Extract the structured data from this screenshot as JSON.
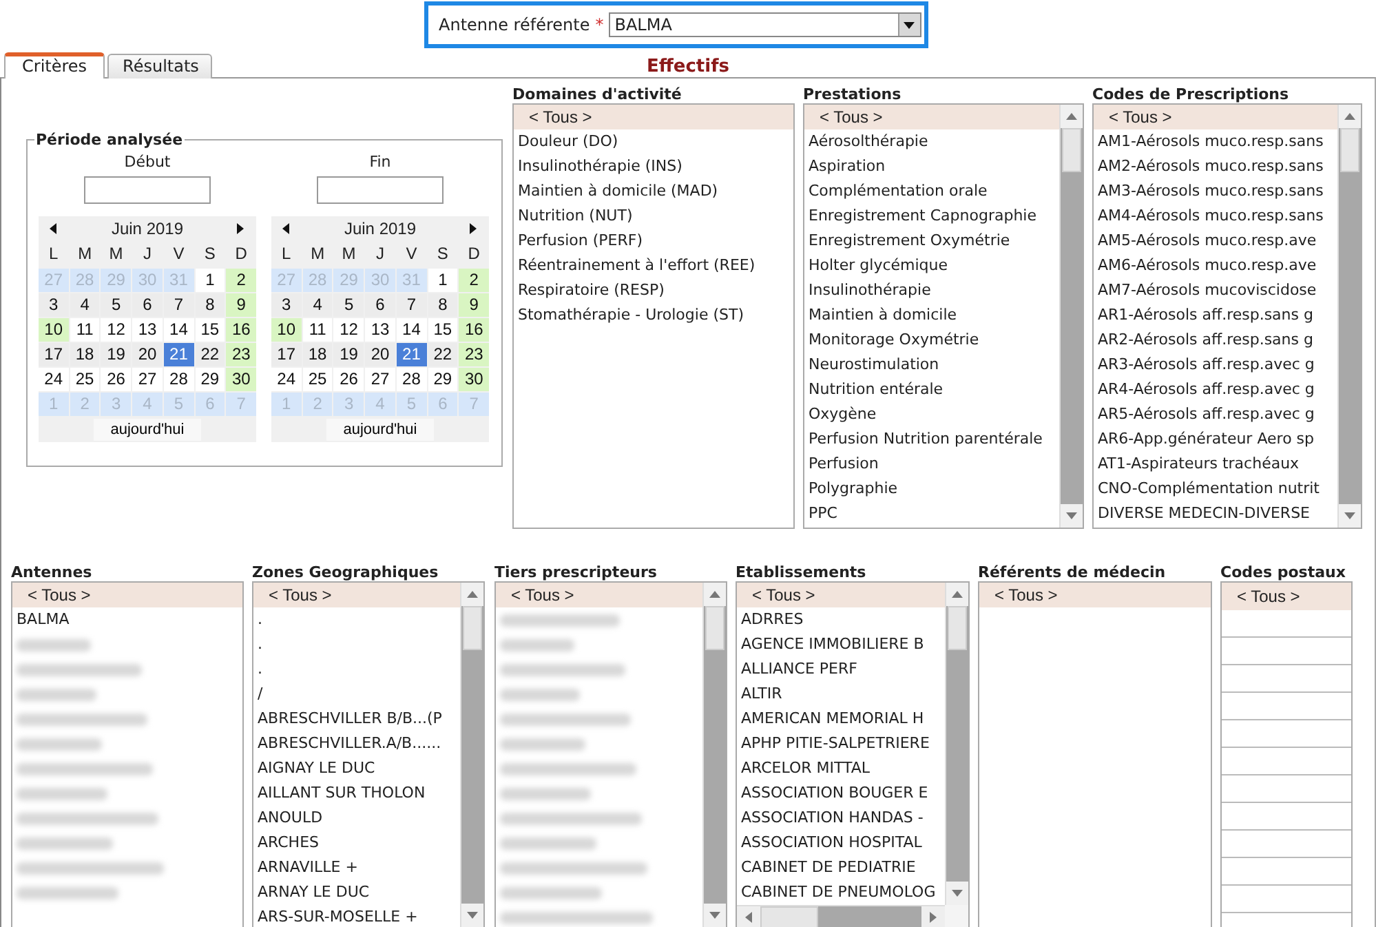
{
  "antenne": {
    "label": "Antenne référente",
    "required_mark": "*",
    "value": "BALMA"
  },
  "tabs": [
    {
      "label": "Critères",
      "selected": true
    },
    {
      "label": "Résultats",
      "selected": false
    }
  ],
  "title": "Effectifs",
  "periode": {
    "legend": "Période analysée",
    "fields": [
      {
        "label": "Début",
        "calendar": {
          "month": "Juin 2019",
          "weekdays": [
            "L",
            "M",
            "M",
            "J",
            "V",
            "S",
            "D"
          ],
          "today_button": "aujourd'hui",
          "weeks": [
            [
              {
                "day": "27",
                "kind": "other",
                "selected": false
              },
              {
                "day": "28",
                "kind": "other",
                "selected": false
              },
              {
                "day": "29",
                "kind": "other",
                "selected": false
              },
              {
                "day": "30",
                "kind": "other",
                "selected": false
              },
              {
                "day": "31",
                "kind": "other",
                "selected": false
              },
              {
                "day": "1",
                "kind": "day",
                "selected": false
              },
              {
                "day": "2",
                "kind": "weekend",
                "selected": false
              }
            ],
            [
              {
                "day": "3",
                "kind": "day",
                "selected": false
              },
              {
                "day": "4",
                "kind": "day",
                "selected": false
              },
              {
                "day": "5",
                "kind": "day",
                "selected": false
              },
              {
                "day": "6",
                "kind": "day",
                "selected": false
              },
              {
                "day": "7",
                "kind": "day",
                "selected": false
              },
              {
                "day": "8",
                "kind": "day",
                "selected": false
              },
              {
                "day": "9",
                "kind": "weekend",
                "selected": false
              }
            ],
            [
              {
                "day": "10",
                "kind": "holiday",
                "selected": false
              },
              {
                "day": "11",
                "kind": "day",
                "selected": false
              },
              {
                "day": "12",
                "kind": "day",
                "selected": false
              },
              {
                "day": "13",
                "kind": "day",
                "selected": false
              },
              {
                "day": "14",
                "kind": "day",
                "selected": false
              },
              {
                "day": "15",
                "kind": "day",
                "selected": false
              },
              {
                "day": "16",
                "kind": "weekend",
                "selected": false
              }
            ],
            [
              {
                "day": "17",
                "kind": "day",
                "selected": false
              },
              {
                "day": "18",
                "kind": "day",
                "selected": false
              },
              {
                "day": "19",
                "kind": "day",
                "selected": false
              },
              {
                "day": "20",
                "kind": "day",
                "selected": false
              },
              {
                "day": "21",
                "kind": "day",
                "selected": true
              },
              {
                "day": "22",
                "kind": "day",
                "selected": false
              },
              {
                "day": "23",
                "kind": "weekend",
                "selected": false
              }
            ],
            [
              {
                "day": "24",
                "kind": "day",
                "selected": false
              },
              {
                "day": "25",
                "kind": "day",
                "selected": false
              },
              {
                "day": "26",
                "kind": "day",
                "selected": false
              },
              {
                "day": "27",
                "kind": "day",
                "selected": false
              },
              {
                "day": "28",
                "kind": "day",
                "selected": false
              },
              {
                "day": "29",
                "kind": "day",
                "selected": false
              },
              {
                "day": "30",
                "kind": "weekend",
                "selected": false
              }
            ],
            [
              {
                "day": "1",
                "kind": "other",
                "selected": false
              },
              {
                "day": "2",
                "kind": "other",
                "selected": false
              },
              {
                "day": "3",
                "kind": "other",
                "selected": false
              },
              {
                "day": "4",
                "kind": "other",
                "selected": false
              },
              {
                "day": "5",
                "kind": "other",
                "selected": false
              },
              {
                "day": "6",
                "kind": "other",
                "selected": false
              },
              {
                "day": "7",
                "kind": "other",
                "selected": false
              }
            ]
          ]
        }
      },
      {
        "label": "Fin",
        "calendar": {
          "month": "Juin 2019",
          "weekdays": [
            "L",
            "M",
            "M",
            "J",
            "V",
            "S",
            "D"
          ],
          "today_button": "aujourd'hui",
          "weeks": [
            [
              {
                "day": "27",
                "kind": "other",
                "selected": false
              },
              {
                "day": "28",
                "kind": "other",
                "selected": false
              },
              {
                "day": "29",
                "kind": "other",
                "selected": false
              },
              {
                "day": "30",
                "kind": "other",
                "selected": false
              },
              {
                "day": "31",
                "kind": "other",
                "selected": false
              },
              {
                "day": "1",
                "kind": "day",
                "selected": false
              },
              {
                "day": "2",
                "kind": "weekend",
                "selected": false
              }
            ],
            [
              {
                "day": "3",
                "kind": "day",
                "selected": false
              },
              {
                "day": "4",
                "kind": "day",
                "selected": false
              },
              {
                "day": "5",
                "kind": "day",
                "selected": false
              },
              {
                "day": "6",
                "kind": "day",
                "selected": false
              },
              {
                "day": "7",
                "kind": "day",
                "selected": false
              },
              {
                "day": "8",
                "kind": "day",
                "selected": false
              },
              {
                "day": "9",
                "kind": "weekend",
                "selected": false
              }
            ],
            [
              {
                "day": "10",
                "kind": "holiday",
                "selected": false
              },
              {
                "day": "11",
                "kind": "day",
                "selected": false
              },
              {
                "day": "12",
                "kind": "day",
                "selected": false
              },
              {
                "day": "13",
                "kind": "day",
                "selected": false
              },
              {
                "day": "14",
                "kind": "day",
                "selected": false
              },
              {
                "day": "15",
                "kind": "day",
                "selected": false
              },
              {
                "day": "16",
                "kind": "weekend",
                "selected": false
              }
            ],
            [
              {
                "day": "17",
                "kind": "day",
                "selected": false
              },
              {
                "day": "18",
                "kind": "day",
                "selected": false
              },
              {
                "day": "19",
                "kind": "day",
                "selected": false
              },
              {
                "day": "20",
                "kind": "day",
                "selected": false
              },
              {
                "day": "21",
                "kind": "day",
                "selected": true
              },
              {
                "day": "22",
                "kind": "day",
                "selected": false
              },
              {
                "day": "23",
                "kind": "weekend",
                "selected": false
              }
            ],
            [
              {
                "day": "24",
                "kind": "day",
                "selected": false
              },
              {
                "day": "25",
                "kind": "day",
                "selected": false
              },
              {
                "day": "26",
                "kind": "day",
                "selected": false
              },
              {
                "day": "27",
                "kind": "day",
                "selected": false
              },
              {
                "day": "28",
                "kind": "day",
                "selected": false
              },
              {
                "day": "29",
                "kind": "day",
                "selected": false
              },
              {
                "day": "30",
                "kind": "weekend",
                "selected": false
              }
            ],
            [
              {
                "day": "1",
                "kind": "other",
                "selected": false
              },
              {
                "day": "2",
                "kind": "other",
                "selected": false
              },
              {
                "day": "3",
                "kind": "other",
                "selected": false
              },
              {
                "day": "4",
                "kind": "other",
                "selected": false
              },
              {
                "day": "5",
                "kind": "other",
                "selected": false
              },
              {
                "day": "6",
                "kind": "other",
                "selected": false
              },
              {
                "day": "7",
                "kind": "other",
                "selected": false
              }
            ]
          ]
        }
      }
    ]
  },
  "lists_top": [
    {
      "title": "Domaines d'activité",
      "items": [
        {
          "kind": "text",
          "label": "< Tous >",
          "selected": true
        },
        {
          "kind": "text",
          "label": "Douleur (DO)",
          "selected": false
        },
        {
          "kind": "text",
          "label": "Insulinothérapie (INS)",
          "selected": false
        },
        {
          "kind": "text",
          "label": "Maintien à domicile (MAD)",
          "selected": false
        },
        {
          "kind": "text",
          "label": "Nutrition (NUT)",
          "selected": false
        },
        {
          "kind": "text",
          "label": "Perfusion (PERF)",
          "selected": false
        },
        {
          "kind": "text",
          "label": "Réentrainement à l'effort (REE)",
          "selected": false
        },
        {
          "kind": "text",
          "label": "Respiratoire (RESP)",
          "selected": false
        },
        {
          "kind": "text",
          "label": "Stomathérapie - Urologie (ST)",
          "selected": false
        }
      ]
    },
    {
      "title": "Prestations",
      "items": [
        {
          "kind": "text",
          "label": "< Tous >",
          "selected": true
        },
        {
          "kind": "text",
          "label": "Aérosolthérapie",
          "selected": false
        },
        {
          "kind": "text",
          "label": "Aspiration",
          "selected": false
        },
        {
          "kind": "text",
          "label": "Complémentation orale",
          "selected": false
        },
        {
          "kind": "text",
          "label": "Enregistrement Capnographie",
          "selected": false
        },
        {
          "kind": "text",
          "label": "Enregistrement Oxymétrie",
          "selected": false
        },
        {
          "kind": "text",
          "label": "Holter glycémique",
          "selected": false
        },
        {
          "kind": "text",
          "label": "Insulinothérapie",
          "selected": false
        },
        {
          "kind": "text",
          "label": "Maintien à domicile",
          "selected": false
        },
        {
          "kind": "text",
          "label": "Monitorage Oxymétrie",
          "selected": false
        },
        {
          "kind": "text",
          "label": "Neurostimulation",
          "selected": false
        },
        {
          "kind": "text",
          "label": "Nutrition entérale",
          "selected": false
        },
        {
          "kind": "text",
          "label": "Oxygène",
          "selected": false
        },
        {
          "kind": "text",
          "label": "Perfusion Nutrition parentérale",
          "selected": false
        },
        {
          "kind": "text",
          "label": "Perfusion",
          "selected": false
        },
        {
          "kind": "text",
          "label": "Polygraphie",
          "selected": false
        },
        {
          "kind": "text",
          "label": "PPC",
          "selected": false
        }
      ]
    },
    {
      "title": "Codes de Prescriptions",
      "items": [
        {
          "kind": "text",
          "label": "< Tous >",
          "selected": true
        },
        {
          "kind": "text",
          "label": "AM1-Aérosols muco.resp.sans",
          "selected": false
        },
        {
          "kind": "text",
          "label": "AM2-Aérosols muco.resp.sans",
          "selected": false
        },
        {
          "kind": "text",
          "label": "AM3-Aérosols muco.resp.sans",
          "selected": false
        },
        {
          "kind": "text",
          "label": "AM4-Aérosols muco.resp.sans",
          "selected": false
        },
        {
          "kind": "text",
          "label": "AM5-Aérosols muco.resp.ave",
          "selected": false
        },
        {
          "kind": "text",
          "label": "AM6-Aérosols muco.resp.ave",
          "selected": false
        },
        {
          "kind": "text",
          "label": "AM7-Aérosols mucoviscidose",
          "selected": false
        },
        {
          "kind": "text",
          "label": "AR1-Aérosols aff.resp.sans g",
          "selected": false
        },
        {
          "kind": "text",
          "label": "AR2-Aérosols aff.resp.sans g",
          "selected": false
        },
        {
          "kind": "text",
          "label": "AR3-Aérosols aff.resp.avec g",
          "selected": false
        },
        {
          "kind": "text",
          "label": "AR4-Aérosols aff.resp.avec g",
          "selected": false
        },
        {
          "kind": "text",
          "label": "AR5-Aérosols aff.resp.avec g",
          "selected": false
        },
        {
          "kind": "text",
          "label": "AR6-App.générateur Aero sp",
          "selected": false
        },
        {
          "kind": "text",
          "label": "AT1-Aspirateurs trachéaux",
          "selected": false
        },
        {
          "kind": "text",
          "label": "CNO-Complémentation nutrit",
          "selected": false
        },
        {
          "kind": "text",
          "label": "DIVERSE MEDECIN-DIVERSE",
          "selected": false
        }
      ]
    }
  ],
  "lists_bottom": [
    {
      "title": "Antennes",
      "items": [
        {
          "kind": "text",
          "label": "< Tous >",
          "selected": true
        },
        {
          "kind": "text",
          "label": "BALMA",
          "selected": false
        },
        {
          "kind": "redacted",
          "selected": false
        },
        {
          "kind": "redacted",
          "selected": false
        },
        {
          "kind": "redacted",
          "selected": false
        },
        {
          "kind": "redacted",
          "selected": false
        },
        {
          "kind": "redacted",
          "selected": false
        },
        {
          "kind": "redacted",
          "selected": false
        },
        {
          "kind": "redacted",
          "selected": false
        },
        {
          "kind": "redacted",
          "selected": false
        },
        {
          "kind": "redacted",
          "selected": false
        },
        {
          "kind": "redacted",
          "selected": false
        },
        {
          "kind": "redacted",
          "selected": false
        }
      ]
    },
    {
      "title": "Zones Geographiques",
      "items": [
        {
          "kind": "text",
          "label": "< Tous >",
          "selected": true
        },
        {
          "kind": "text",
          "label": ".",
          "selected": false
        },
        {
          "kind": "text",
          "label": ".",
          "selected": false
        },
        {
          "kind": "text",
          "label": ".",
          "selected": false
        },
        {
          "kind": "text",
          "label": "/",
          "selected": false
        },
        {
          "kind": "text",
          "label": "ABRESCHVILLER B/B...(P",
          "selected": false
        },
        {
          "kind": "text",
          "label": "ABRESCHVILLER.A/B......",
          "selected": false
        },
        {
          "kind": "text",
          "label": "AIGNAY LE DUC",
          "selected": false
        },
        {
          "kind": "text",
          "label": "AILLANT SUR THOLON",
          "selected": false
        },
        {
          "kind": "text",
          "label": "ANOULD",
          "selected": false
        },
        {
          "kind": "text",
          "label": "ARCHES",
          "selected": false
        },
        {
          "kind": "text",
          "label": "ARNAVILLE +",
          "selected": false
        },
        {
          "kind": "text",
          "label": "ARNAY LE DUC",
          "selected": false
        },
        {
          "kind": "text",
          "label": "ARS-SUR-MOSELLE +",
          "selected": false
        }
      ]
    },
    {
      "title": "Tiers prescripteurs",
      "items": [
        {
          "kind": "text",
          "label": "< Tous >",
          "selected": true
        },
        {
          "kind": "redacted",
          "selected": false
        },
        {
          "kind": "redacted",
          "selected": false
        },
        {
          "kind": "redacted",
          "selected": false
        },
        {
          "kind": "redacted",
          "selected": false
        },
        {
          "kind": "redacted",
          "selected": false
        },
        {
          "kind": "redacted",
          "selected": false
        },
        {
          "kind": "redacted",
          "selected": false
        },
        {
          "kind": "redacted",
          "selected": false
        },
        {
          "kind": "redacted",
          "selected": false
        },
        {
          "kind": "redacted",
          "selected": false
        },
        {
          "kind": "redacted",
          "selected": false
        },
        {
          "kind": "redacted",
          "selected": false
        },
        {
          "kind": "redacted",
          "selected": false
        }
      ]
    },
    {
      "title": "Etablissements",
      "items": [
        {
          "kind": "text",
          "label": "< Tous >",
          "selected": true
        },
        {
          "kind": "text",
          "label": "ADRRES",
          "selected": false
        },
        {
          "kind": "text",
          "label": "AGENCE IMMOBILIERE B",
          "selected": false
        },
        {
          "kind": "text",
          "label": "ALLIANCE PERF",
          "selected": false
        },
        {
          "kind": "text",
          "label": "ALTIR",
          "selected": false
        },
        {
          "kind": "text",
          "label": "AMERICAN MEMORIAL H",
          "selected": false
        },
        {
          "kind": "text",
          "label": "APHP PITIE-SALPETRIERE",
          "selected": false
        },
        {
          "kind": "text",
          "label": "ARCELOR MITTAL",
          "selected": false
        },
        {
          "kind": "text",
          "label": "ASSOCIATION BOUGER E",
          "selected": false
        },
        {
          "kind": "text",
          "label": "ASSOCIATION HANDAS -",
          "selected": false
        },
        {
          "kind": "text",
          "label": "ASSOCIATION HOSPITAL",
          "selected": false
        },
        {
          "kind": "text",
          "label": "CABINET DE PEDIATRIE",
          "selected": false
        },
        {
          "kind": "text",
          "label": "CABINET DE PNEUMOLOG",
          "selected": false
        }
      ]
    },
    {
      "title": "Référents de médecin",
      "items": [
        {
          "kind": "text",
          "label": "< Tous >",
          "selected": true
        }
      ]
    },
    {
      "title": "Codes postaux",
      "items": [
        {
          "kind": "text",
          "label": "< Tous >",
          "selected": true
        }
      ]
    }
  ]
}
